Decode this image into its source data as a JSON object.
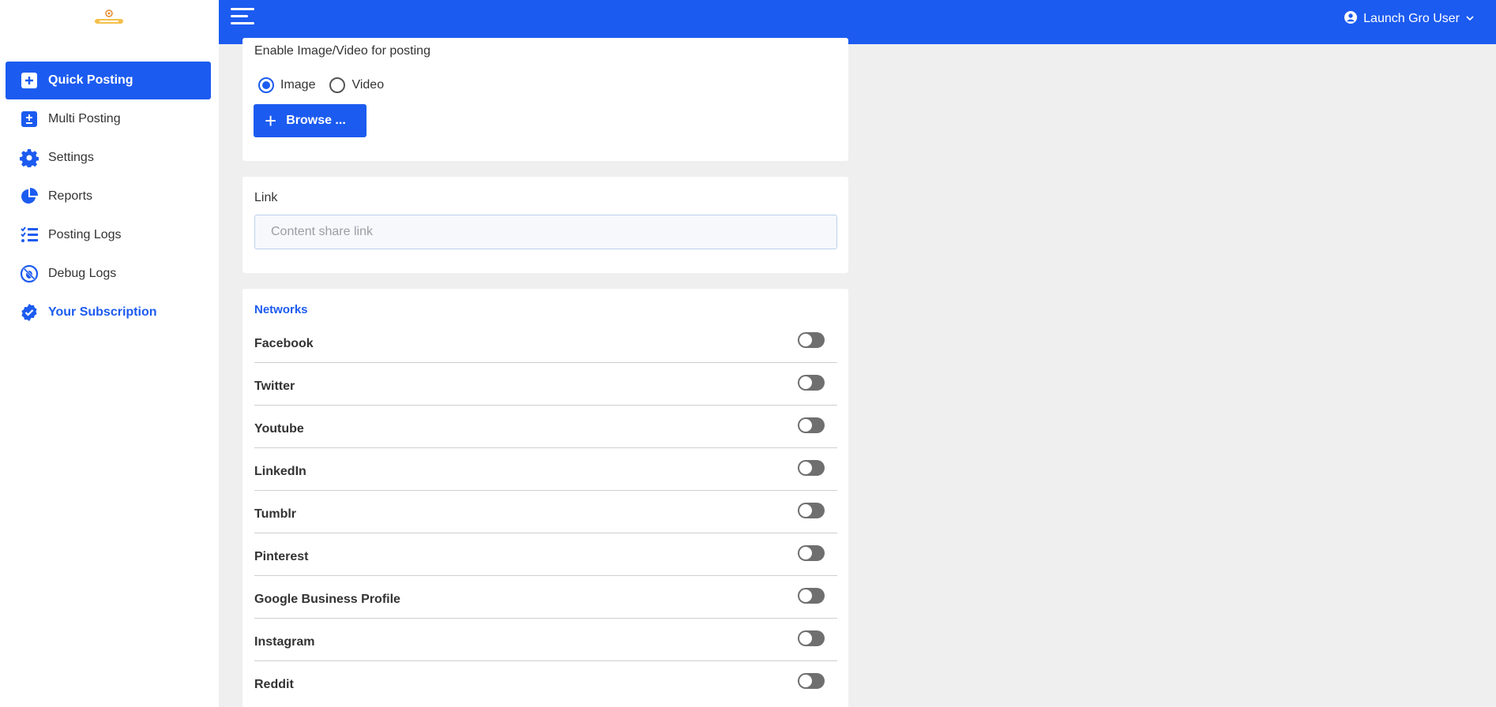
{
  "sidebar": {
    "logo": "launch-gro-logo",
    "items": [
      {
        "label": "Quick Posting",
        "icon": "plus-square-icon"
      },
      {
        "label": "Multi Posting",
        "icon": "plus-minus-icon"
      },
      {
        "label": "Settings",
        "icon": "gear-icon"
      },
      {
        "label": "Reports",
        "icon": "pie-chart-icon"
      },
      {
        "label": "Posting Logs",
        "icon": "checklist-icon"
      },
      {
        "label": "Debug Logs",
        "icon": "bug-off-icon"
      },
      {
        "label": "Your Subscription",
        "icon": "badge-check-icon"
      }
    ]
  },
  "topbar": {
    "user_label": "Launch Gro User"
  },
  "media": {
    "title": "Enable Image/Video for posting",
    "options": [
      "Image",
      "Video"
    ],
    "selected": "Image",
    "browse_label": "Browse ..."
  },
  "link": {
    "label": "Link",
    "placeholder": "Content share link"
  },
  "networks": {
    "title": "Networks",
    "items": [
      {
        "name": "Facebook",
        "enabled": false
      },
      {
        "name": "Twitter",
        "enabled": false
      },
      {
        "name": "Youtube",
        "enabled": false
      },
      {
        "name": "LinkedIn",
        "enabled": false
      },
      {
        "name": "Tumblr",
        "enabled": false
      },
      {
        "name": "Pinterest",
        "enabled": false
      },
      {
        "name": "Google Business Profile",
        "enabled": false
      },
      {
        "name": "Instagram",
        "enabled": false
      },
      {
        "name": "Reddit",
        "enabled": false
      }
    ]
  },
  "colors": {
    "accent": "#1c5bf0",
    "background": "#efefef",
    "toggle_off": "#6f6f6f"
  }
}
